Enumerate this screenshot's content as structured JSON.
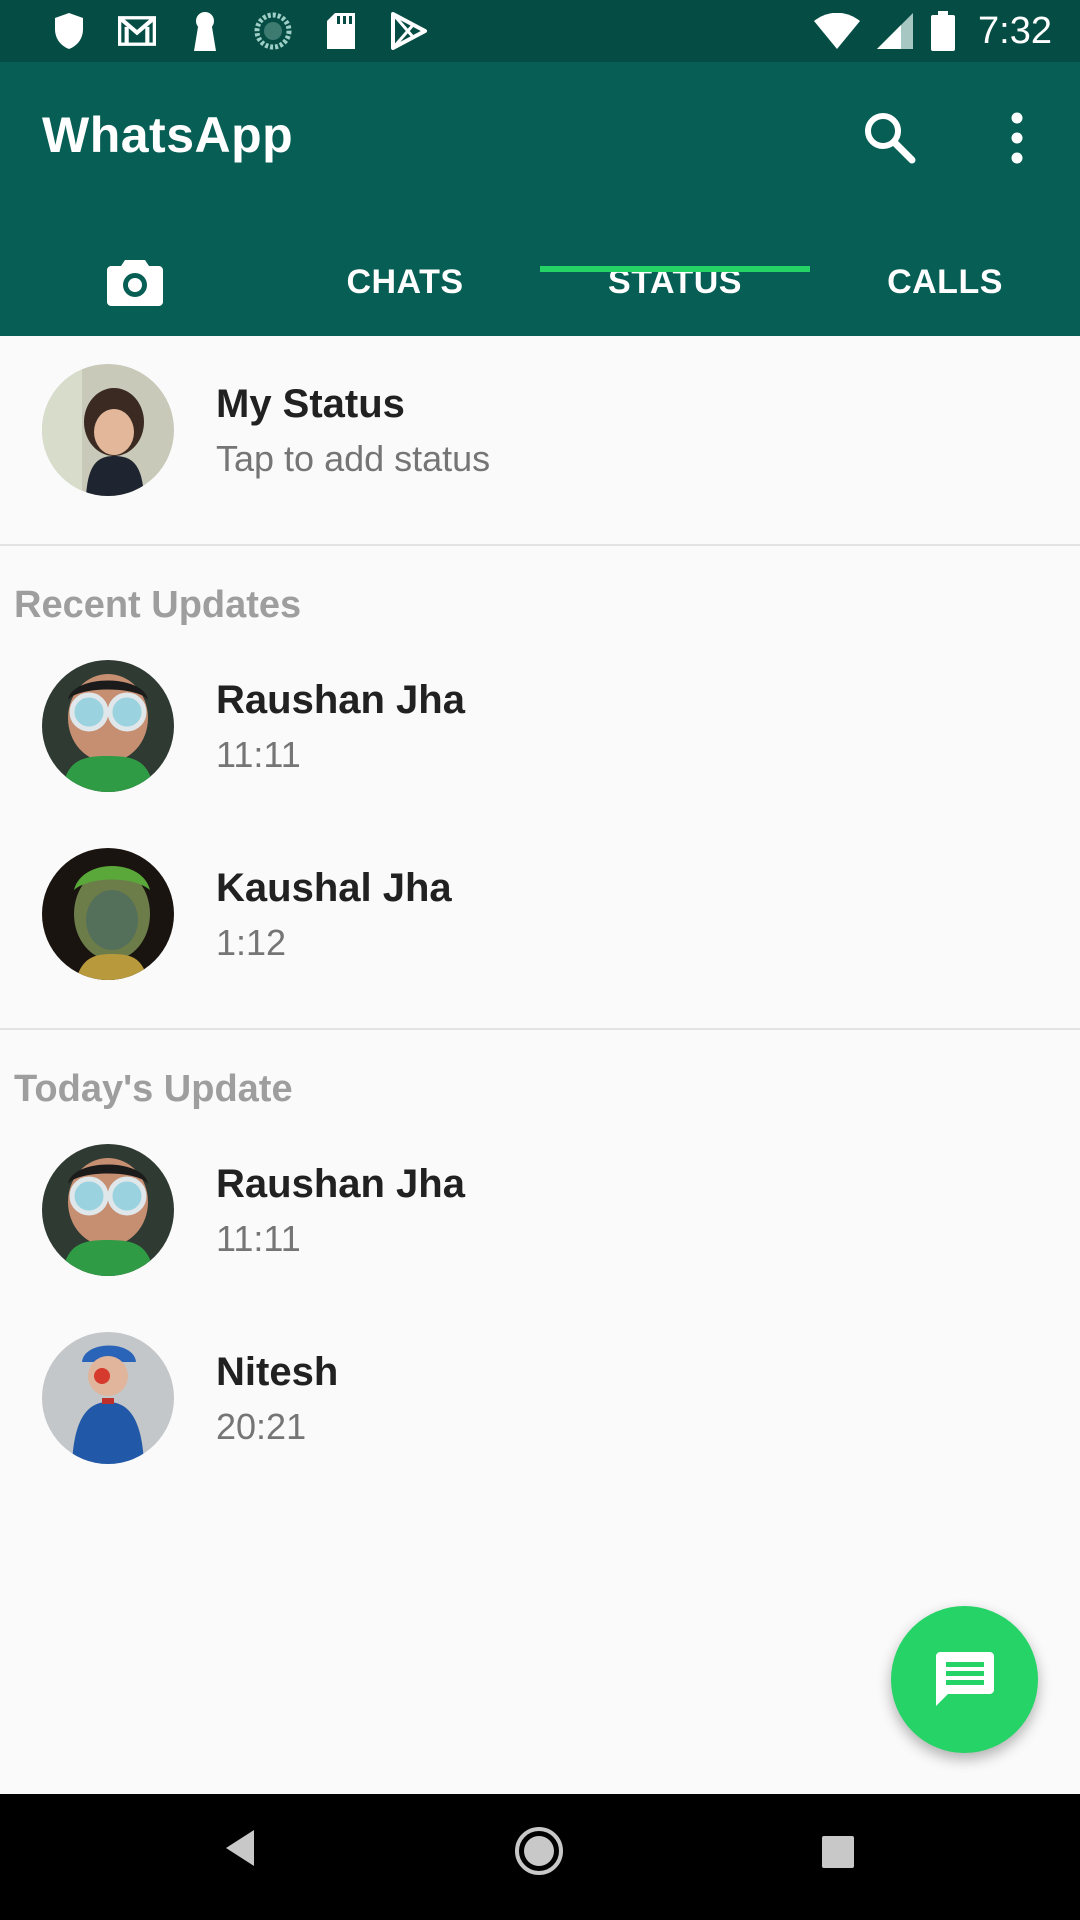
{
  "status_bar": {
    "time": "7:32",
    "left_icons": [
      "shield-icon",
      "gmail-icon",
      "keyhole-icon",
      "sync-icon",
      "sdcard-icon",
      "play-store-icon"
    ],
    "right_icons": [
      "wifi-icon",
      "signal-icon",
      "battery-icon"
    ]
  },
  "app_bar": {
    "title": "WhatsApp",
    "actions": [
      "search-icon",
      "more-vert-icon"
    ]
  },
  "tabs": [
    {
      "label": "",
      "icon": "camera-icon"
    },
    {
      "label": "CHATS"
    },
    {
      "label": "STATUS",
      "selected": true
    },
    {
      "label": "CALLS"
    }
  ],
  "my_status": {
    "name": "My Status",
    "subtitle": "Tap to add status"
  },
  "sections": [
    {
      "header": "Recent Updates",
      "items": [
        {
          "name": "Raushan Jha",
          "time": "11:11"
        },
        {
          "name": "Kaushal Jha",
          "time": "1:12"
        }
      ]
    },
    {
      "header": "Today's Update",
      "items": [
        {
          "name": "Raushan Jha",
          "time": "11:11"
        },
        {
          "name": "Nitesh",
          "time": "20:21"
        }
      ]
    }
  ],
  "fab": {
    "icon": "message-icon"
  },
  "nav_bar": [
    "back-icon",
    "home-icon",
    "recents-icon"
  ],
  "colors": {
    "primary_dark": "#054d44",
    "primary": "#075e54",
    "accent": "#25d366"
  }
}
